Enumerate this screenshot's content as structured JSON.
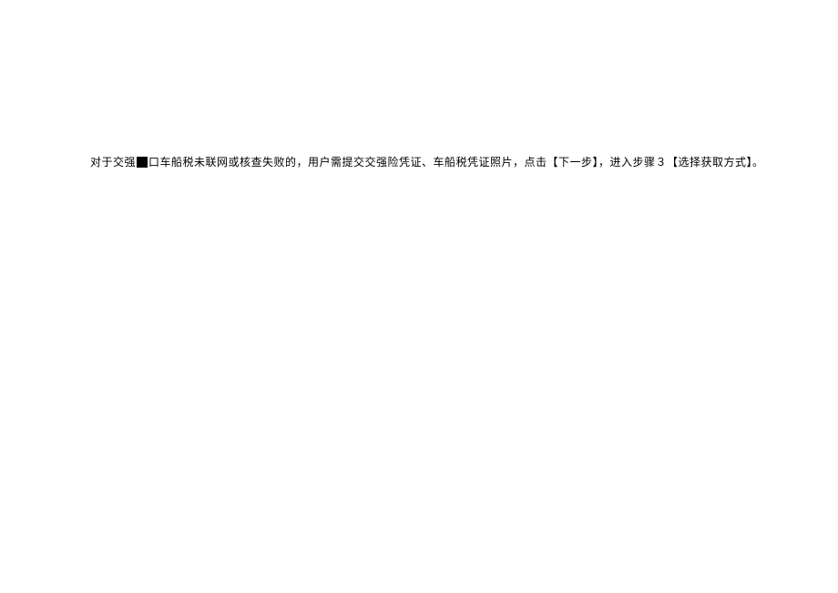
{
  "document": {
    "paragraph": {
      "text_part1": "对于交强",
      "text_part2": "口车船税未联网或核查失败的，用户需提交交强险凭证、车船税凭证照片，点击【下一步】，进入步骤３【选择获取方式】。"
    }
  }
}
